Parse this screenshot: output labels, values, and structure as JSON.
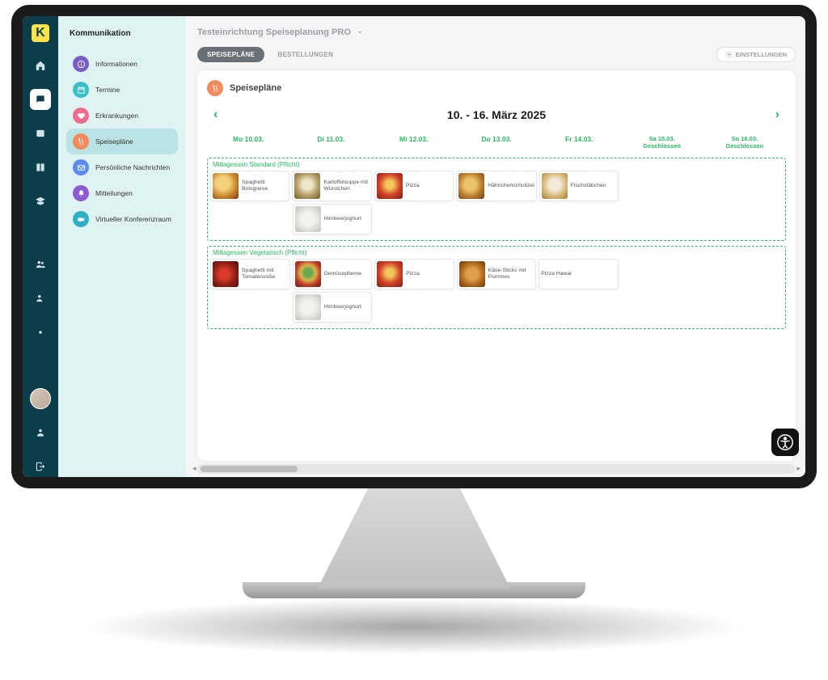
{
  "app": {
    "logo_letter": "K"
  },
  "rail": [
    "home",
    "chat",
    "image",
    "book",
    "grad",
    "spacer",
    "users",
    "user-add",
    "gear",
    "spacer2",
    "avatar",
    "user",
    "logout"
  ],
  "sidebar": {
    "title": "Kommunikation",
    "items": [
      {
        "label": "Informationen",
        "color": "c-purple",
        "icon": "info"
      },
      {
        "label": "Termine",
        "color": "c-teal",
        "icon": "calendar"
      },
      {
        "label": "Erkrankungen",
        "color": "c-pink",
        "icon": "heart"
      },
      {
        "label": "Speisepläne",
        "color": "c-orange",
        "icon": "utensils",
        "active": true
      },
      {
        "label": "Persönliche Nachrichten",
        "color": "c-blue",
        "icon": "mail"
      },
      {
        "label": "Mitteilungen",
        "color": "c-purple2",
        "icon": "bell"
      },
      {
        "label": "Virtueller Konferenzraum",
        "color": "c-cyan",
        "icon": "video"
      }
    ]
  },
  "header": {
    "breadcrumb": "Testeinrichtung Speiseplanung PRO",
    "tabs": [
      {
        "label": "SPEISEPLÄNE",
        "active": true
      },
      {
        "label": "BESTELLUNGEN",
        "active": false
      }
    ],
    "settings_label": "EINSTELLUNGEN"
  },
  "card": {
    "title": "Speisepläne",
    "week_label": "10. - 16. März 2025",
    "days": [
      {
        "label": "Mo 10.03."
      },
      {
        "label": "Di 11.03."
      },
      {
        "label": "Mi 12.03."
      },
      {
        "label": "Do 13.03."
      },
      {
        "label": "Fr 14.03."
      },
      {
        "label": "Sa 15.03.",
        "sub": "Geschlossen"
      },
      {
        "label": "So 16.03.",
        "sub": "Geschlossen"
      }
    ],
    "groups": [
      {
        "title": "Mittagessen Standard (Pflicht)",
        "rows": [
          [
            {
              "label": "Spaghetti Bolognese",
              "img": "f1"
            },
            {
              "label": "Kartoffelsuppe mit Würstchen",
              "img": "f2"
            },
            {
              "label": "Pizza",
              "img": "f4"
            },
            {
              "label": "Hähnchenschnitzel",
              "img": "f5"
            },
            {
              "label": "Fischstäbchen",
              "img": "f6"
            },
            null,
            null
          ],
          [
            null,
            {
              "label": "Himbeerjoghurt",
              "img": "f3"
            },
            null,
            null,
            null,
            null,
            null
          ]
        ]
      },
      {
        "title": "Mittagessen Vegetarisch (Pflicht)",
        "rows": [
          [
            {
              "label": "Spaghetti mit Tomatensoße",
              "img": "f7"
            },
            {
              "label": "Gemüsepfanne",
              "img": "f8"
            },
            {
              "label": "Pizza",
              "img": "f4"
            },
            {
              "label": "Käse-Sticks mit Pommes",
              "img": "f9"
            },
            {
              "label": "Pizza Hawai",
              "img": ""
            },
            null,
            null
          ],
          [
            null,
            {
              "label": "Himbeerjoghurt",
              "img": "f3"
            },
            null,
            null,
            null,
            null,
            null
          ]
        ]
      }
    ]
  }
}
